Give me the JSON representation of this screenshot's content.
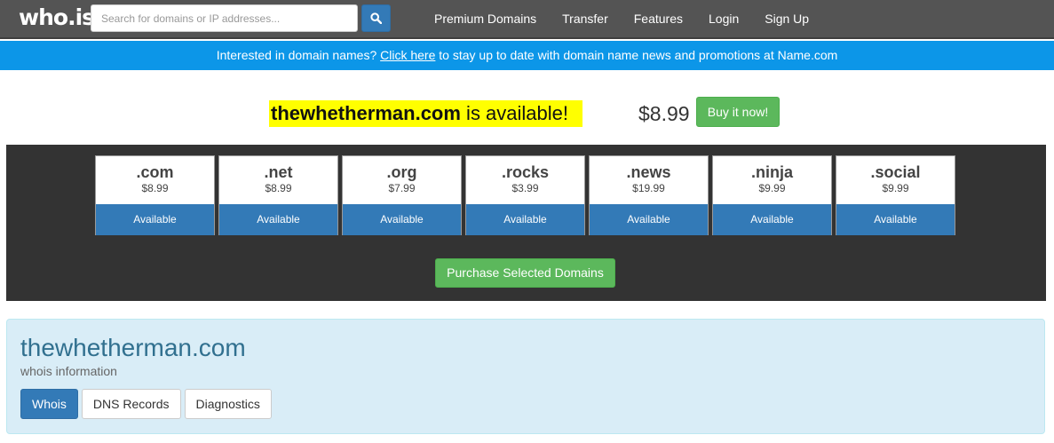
{
  "header": {
    "logo": "who.is",
    "search_placeholder": "Search for domains or IP addresses...",
    "search_icon": "search-icon",
    "nav": [
      "Premium Domains",
      "Transfer",
      "Features",
      "Login",
      "Sign Up"
    ]
  },
  "promo": {
    "prefix": "Interested in domain names? ",
    "link": "Click here",
    "suffix": " to stay up to date with domain name news and promotions at Name.com"
  },
  "availability": {
    "domain": "thewhetherman.com",
    "status_text": " is available!",
    "price": "$8.99",
    "buy_label": "Buy it now!"
  },
  "tlds": [
    {
      "name": ".com",
      "price": "$8.99",
      "status": "Available"
    },
    {
      "name": ".net",
      "price": "$8.99",
      "status": "Available"
    },
    {
      "name": ".org",
      "price": "$7.99",
      "status": "Available"
    },
    {
      "name": ".rocks",
      "price": "$3.99",
      "status": "Available"
    },
    {
      "name": ".news",
      "price": "$19.99",
      "status": "Available"
    },
    {
      "name": ".ninja",
      "price": "$9.99",
      "status": "Available"
    },
    {
      "name": ".social",
      "price": "$9.99",
      "status": "Available"
    }
  ],
  "purchase_label": "Purchase Selected Domains",
  "info": {
    "title": "thewhetherman.com",
    "subtitle": "whois information",
    "tabs": [
      "Whois",
      "DNS Records",
      "Diagnostics"
    ],
    "active_tab": "Whois"
  },
  "colors": {
    "topbar": "#545454",
    "promo": "#0c96e8",
    "primary": "#337ab7",
    "success": "#5cb85c",
    "highlight": "#ffff00",
    "dark_panel": "#333333",
    "info_bg": "#d9edf7"
  }
}
